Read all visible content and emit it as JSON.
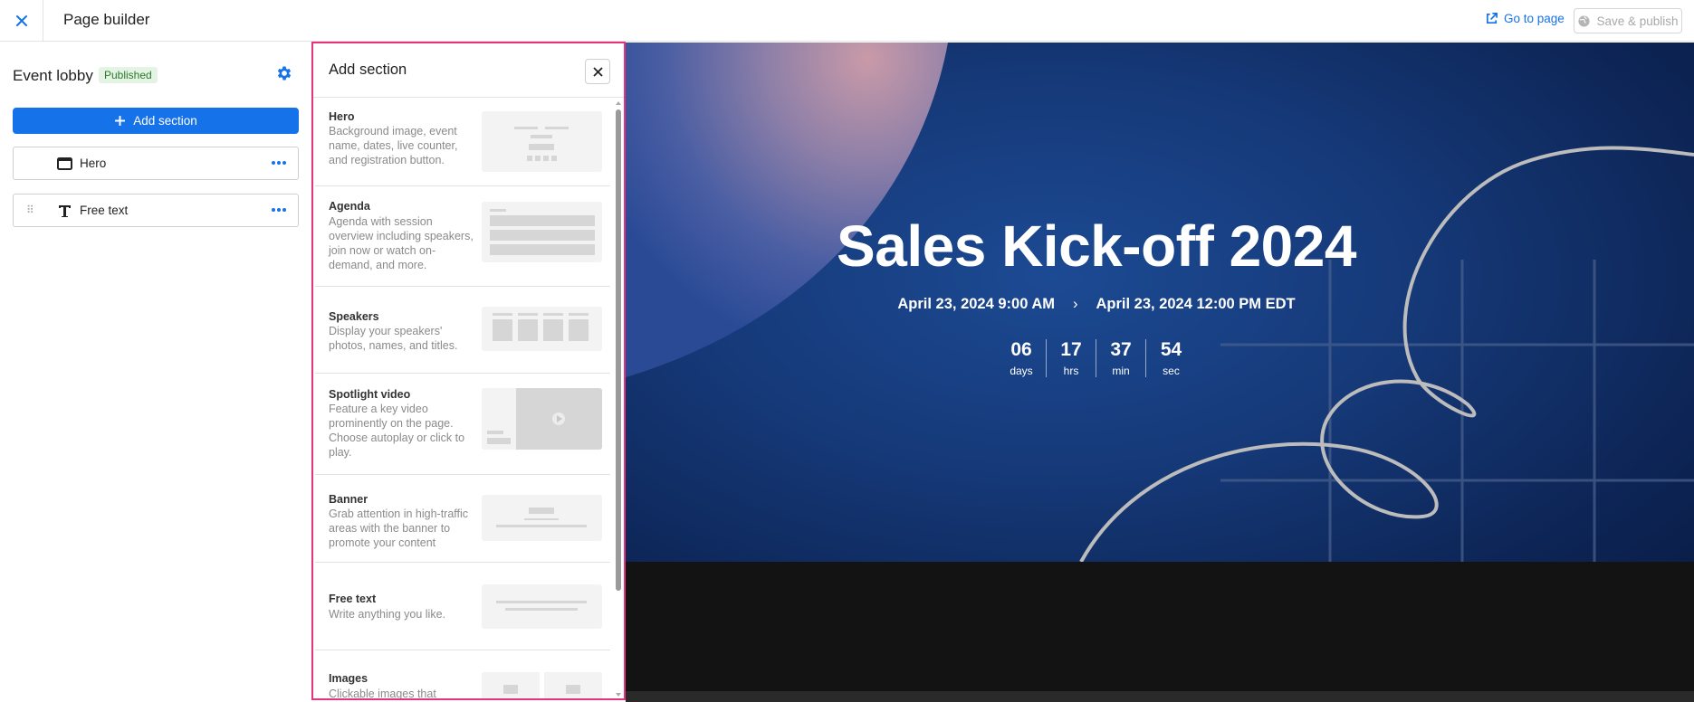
{
  "topbar": {
    "title": "Page builder",
    "goto_label": "Go to page",
    "publish_label": "Save & publish"
  },
  "left_panel": {
    "page_title": "Event lobby",
    "status": "Published",
    "add_section_label": "Add section",
    "sections": [
      {
        "label": "Hero",
        "icon": "window-icon"
      },
      {
        "label": "Free text",
        "icon": "text-icon"
      }
    ]
  },
  "add_panel": {
    "title": "Add section",
    "cards": [
      {
        "name": "Hero",
        "desc": "Background image, event name, dates, live counter, and registration button."
      },
      {
        "name": "Agenda",
        "desc": "Agenda with session overview including speakers, join now or watch on-demand, and more."
      },
      {
        "name": "Speakers",
        "desc": "Display your speakers' photos, names, and titles."
      },
      {
        "name": "Spotlight video",
        "desc": "Feature a key video prominently on the page. Choose autoplay or click to play."
      },
      {
        "name": "Banner",
        "desc": "Grab attention in high-traffic areas with the banner to promote your content"
      },
      {
        "name": "Free text",
        "desc": "Write anything you like."
      },
      {
        "name": "Images",
        "desc": "Clickable images that"
      }
    ]
  },
  "preview": {
    "title": "Sales Kick-off 2024",
    "start": "April 23, 2024 9:00 AM",
    "separator": "›",
    "end": "April 23, 2024 12:00 PM EDT",
    "countdown": [
      {
        "value": "06",
        "unit": "days"
      },
      {
        "value": "17",
        "unit": "hrs"
      },
      {
        "value": "37",
        "unit": "min"
      },
      {
        "value": "54",
        "unit": "sec"
      }
    ]
  },
  "colors": {
    "accent": "#1672e8",
    "highlight_border": "#e8337c",
    "hero_bg": "#163a7a",
    "published_badge": "#e4f3e4"
  }
}
